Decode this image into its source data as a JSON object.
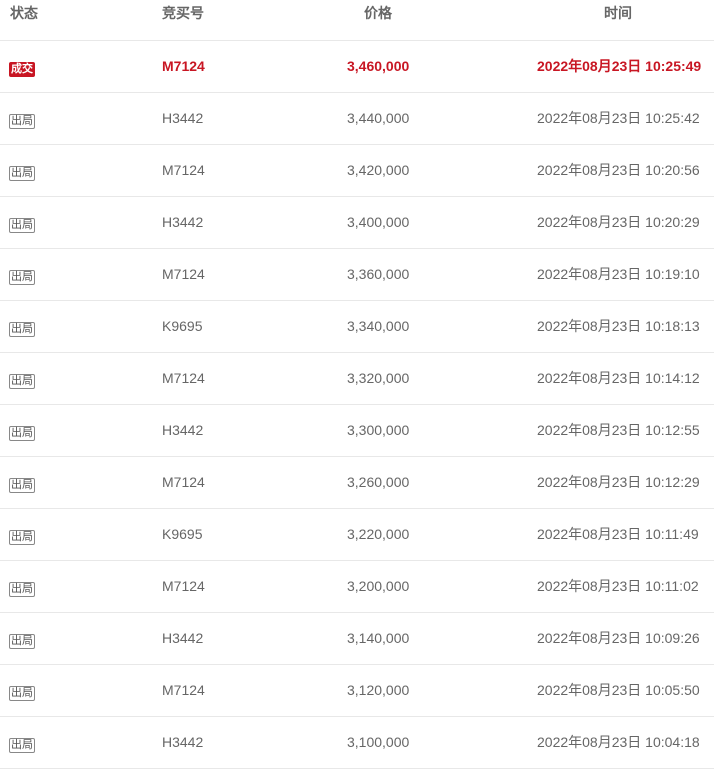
{
  "headers": {
    "status": "状态",
    "bidder": "竞买号",
    "price": "价格",
    "time": "时间"
  },
  "colors": {
    "deal_red": "#c81623",
    "text_gray": "#666666",
    "divider": "#e8e8e8"
  },
  "rows": [
    {
      "status": "成交",
      "bidder": "M7124",
      "price": "3,460,000",
      "time": "2022年08月23日 10:25:49",
      "highlight": true
    },
    {
      "status": "出局",
      "bidder": "H3442",
      "price": "3,440,000",
      "time": "2022年08月23日 10:25:42"
    },
    {
      "status": "出局",
      "bidder": "M7124",
      "price": "3,420,000",
      "time": "2022年08月23日 10:20:56"
    },
    {
      "status": "出局",
      "bidder": "H3442",
      "price": "3,400,000",
      "time": "2022年08月23日 10:20:29"
    },
    {
      "status": "出局",
      "bidder": "M7124",
      "price": "3,360,000",
      "time": "2022年08月23日 10:19:10"
    },
    {
      "status": "出局",
      "bidder": "K9695",
      "price": "3,340,000",
      "time": "2022年08月23日 10:18:13"
    },
    {
      "status": "出局",
      "bidder": "M7124",
      "price": "3,320,000",
      "time": "2022年08月23日 10:14:12"
    },
    {
      "status": "出局",
      "bidder": "H3442",
      "price": "3,300,000",
      "time": "2022年08月23日 10:12:55"
    },
    {
      "status": "出局",
      "bidder": "M7124",
      "price": "3,260,000",
      "time": "2022年08月23日 10:12:29"
    },
    {
      "status": "出局",
      "bidder": "K9695",
      "price": "3,220,000",
      "time": "2022年08月23日 10:11:49"
    },
    {
      "status": "出局",
      "bidder": "M7124",
      "price": "3,200,000",
      "time": "2022年08月23日 10:11:02"
    },
    {
      "status": "出局",
      "bidder": "H3442",
      "price": "3,140,000",
      "time": "2022年08月23日 10:09:26"
    },
    {
      "status": "出局",
      "bidder": "M7124",
      "price": "3,120,000",
      "time": "2022年08月23日 10:05:50"
    },
    {
      "status": "出局",
      "bidder": "H3442",
      "price": "3,100,000",
      "time": "2022年08月23日 10:04:18"
    }
  ]
}
